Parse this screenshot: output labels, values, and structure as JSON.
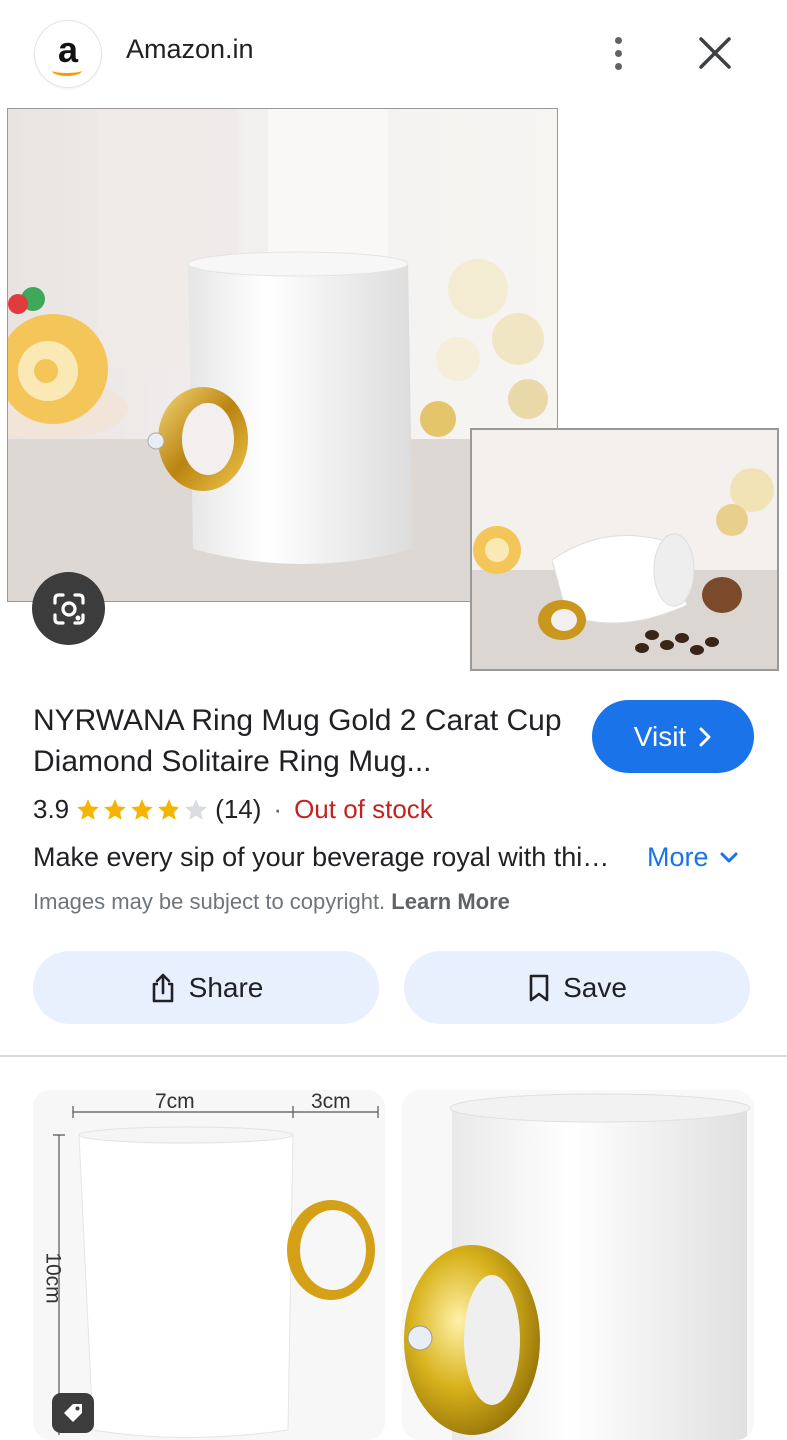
{
  "header": {
    "site_logo_letter": "a",
    "site_name": "Amazon.in",
    "menu_icon": "more-vert-icon",
    "close_icon": "close-icon"
  },
  "product": {
    "title": "NYRWANA Ring Mug Gold 2 Carat Cup Diamond Solitaire Ring Mug...",
    "rating": "3.9",
    "stars": 3.9,
    "review_count": "(14)",
    "separator": "·",
    "stock_status": "Out of stock",
    "description": "Make every sip of your beverage royal with thi…",
    "more_label": "More",
    "copyright_text": "Images may be subject to copyright.",
    "learn_more_label": "Learn More"
  },
  "actions": {
    "visit_label": "Visit",
    "share_label": "Share",
    "save_label": "Save"
  },
  "related": {
    "dim_width": "7cm",
    "dim_handle": "3cm",
    "dim_height": "10cm"
  },
  "colors": {
    "accent": "#1a73e8",
    "pill_bg": "#e8f0fe",
    "out_of_stock": "#c5221f",
    "star": "#f4b400",
    "gold": "#d4a017"
  }
}
